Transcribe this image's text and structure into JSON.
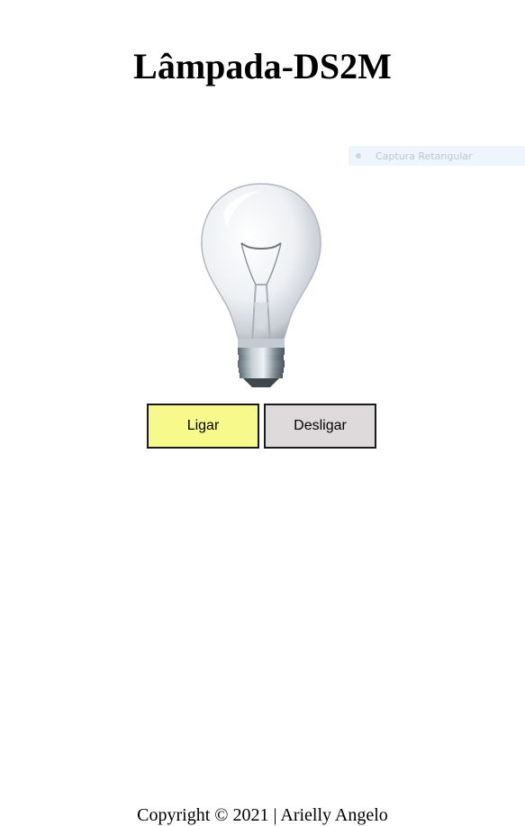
{
  "header": {
    "title": "Lâmpada-DS2M"
  },
  "capture_overlay": {
    "label": "Captura Retangular"
  },
  "lamp": {
    "state": "off",
    "icon": "lightbulb-icon"
  },
  "controls": {
    "on_label": "Ligar",
    "off_label": "Desligar",
    "on_color": "#f7f98b",
    "off_color": "#dedadb"
  },
  "footer": {
    "copyright": "Copyright © 2021 | Arielly Angelo"
  }
}
